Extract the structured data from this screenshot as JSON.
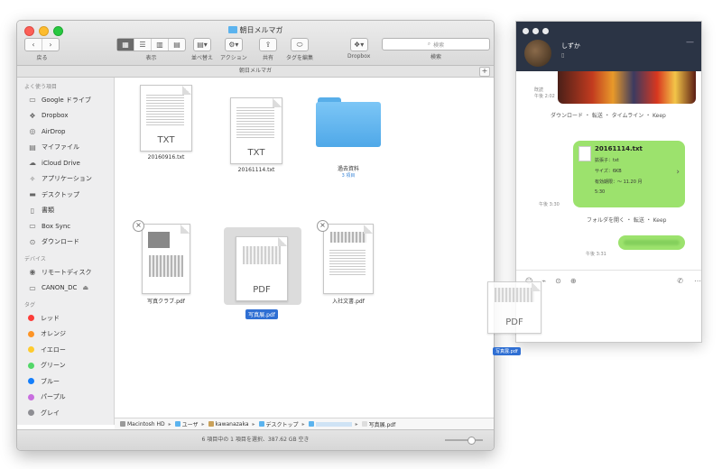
{
  "finder": {
    "title": "朝日メルマガ",
    "path_header": "朝日メルマガ",
    "toolbar": {
      "back_label": "戻る",
      "view_label": "表示",
      "arrange_label": "並べ替え",
      "action_label": "アクション",
      "share_label": "共有",
      "tag_label": "タグを編集",
      "dropbox_label": "Dropbox",
      "search_label": "検索",
      "search_placeholder": "検索"
    },
    "sidebar": {
      "favorites_header": "よく使う項目",
      "favorites": [
        {
          "label": "Google ドライブ",
          "icon": "drive-icon"
        },
        {
          "label": "Dropbox",
          "icon": "dropbox-icon"
        },
        {
          "label": "AirDrop",
          "icon": "airdrop-icon"
        },
        {
          "label": "マイファイル",
          "icon": "myfiles-icon"
        },
        {
          "label": "iCloud Drive",
          "icon": "cloud-icon"
        },
        {
          "label": "アプリケーション",
          "icon": "applications-icon"
        },
        {
          "label": "デスクトップ",
          "icon": "desktop-icon"
        },
        {
          "label": "書類",
          "icon": "documents-icon"
        },
        {
          "label": "Box Sync",
          "icon": "box-icon"
        },
        {
          "label": "ダウンロード",
          "icon": "download-icon"
        }
      ],
      "devices_header": "デバイス",
      "devices": [
        {
          "label": "リモートディスク",
          "icon": "disc-icon"
        },
        {
          "label": "CANON_DC",
          "icon": "drive-icon"
        }
      ],
      "tags_header": "タグ",
      "tags": [
        {
          "label": "レッド",
          "color": "#fc3d39"
        },
        {
          "label": "オレンジ",
          "color": "#fd9426"
        },
        {
          "label": "イエロー",
          "color": "#fecb2f"
        },
        {
          "label": "グリーン",
          "color": "#53d769"
        },
        {
          "label": "ブルー",
          "color": "#147efb"
        },
        {
          "label": "パープル",
          "color": "#c86edf"
        },
        {
          "label": "グレイ",
          "color": "#8e8e93"
        }
      ]
    },
    "files": [
      {
        "name": "20160916.txt",
        "ext": "TXT"
      },
      {
        "name": "20161114.txt",
        "ext": "TXT"
      },
      {
        "name": "過去資料",
        "sub": "3 項目"
      },
      {
        "name": "写真クラブ.pdf",
        "ext": "PDF"
      },
      {
        "name": "写真展.pdf",
        "ext": "PDF"
      },
      {
        "name": "入社文書.pdf",
        "ext": "PDF"
      }
    ],
    "pathbar": [
      "Macintosh HD",
      "ユーザ",
      "kawanazaka",
      "デスクトップ",
      "",
      "写真展.pdf"
    ],
    "status": "6 項目中の 1 項目を選択、387.62 GB 空き"
  },
  "chat": {
    "contact_name": "しずか",
    "msg_photo_time": "既読\n午後 2:02",
    "photo_actions": "ダウンロード ・ 転送 ・ タイムライン ・ Keep",
    "file_bubble": {
      "name": "20161114.txt",
      "line1": "拡張子：txt",
      "line2": "サイズ：6KB",
      "line3": "有効期限：〜 11.20 月",
      "line4": "5:30"
    },
    "file_time": "午後 3:30",
    "file_actions": "フォルダを開く ・ 転送 ・ Keep",
    "text_time": "午後 3:31"
  },
  "drag": {
    "ext": "PDF",
    "label": "写真展.pdf"
  }
}
